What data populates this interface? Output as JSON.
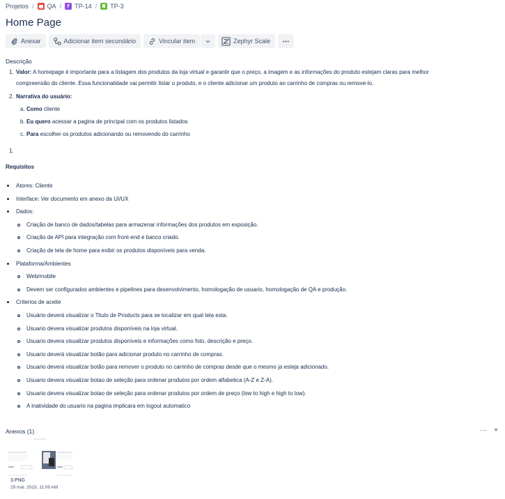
{
  "breadcrumb": {
    "items": [
      {
        "label": "Projetos"
      },
      {
        "label": "QA",
        "icon": "project-icon"
      },
      {
        "label": "TP-14",
        "icon": "epic-icon"
      },
      {
        "label": "TP-3",
        "icon": "story-icon"
      }
    ],
    "separator": "/"
  },
  "issue": {
    "title": "Home Page"
  },
  "toolbar": {
    "attach": "Anexar",
    "child": "Adicionar item secundário",
    "link": "Vincular item",
    "zephyr": "Zephyr Scale"
  },
  "description": {
    "label": "Descrição",
    "item1": {
      "num": "1.",
      "bold": "Valor:",
      "text1": " A homepage é importante para a listagem dos produtos da loja virtual e garantir que o preço, a imagem e as informações do produto estejam claras para melhor",
      "text2": "compreensão do cliente. Essa funcionalidade vai permitir listar o produto, e o cliente adicionar um produto ao carrinho de compras ou remove-lo."
    },
    "item2": {
      "num": "2.",
      "bold": "Narrativa do usuário:",
      "sub": [
        {
          "letter": "a.",
          "bold": "Como",
          "text": " cliente"
        },
        {
          "letter": "b.",
          "bold": "Eu quero",
          "text": " acessar a pagina de principal com os produtos listados"
        },
        {
          "letter": "c.",
          "bold": "Para",
          "text": " escolher os produtos adicionando ou removendo do carrinho"
        }
      ]
    },
    "item3": {
      "num": "1."
    }
  },
  "requirements": {
    "label": "Requisitos",
    "items": [
      {
        "text": "Atores: Cliente"
      },
      {
        "text": "Interface: Ver documento em anexo da UI/UX"
      },
      {
        "text": "Dados:"
      },
      {
        "text": "Criação de banco de dados/tabelas para armazenar informações dos produtos em exposição.",
        "level": 2
      },
      {
        "text": "Criação de API para integração com front-end e banco criado.",
        "level": 2
      },
      {
        "text": "Criação de tela de home para exibir os produtos disponíveis para venda.",
        "level": 2
      },
      {
        "text": "Plataforma/Ambientes"
      },
      {
        "text": "Web/mobile",
        "level": 2
      },
      {
        "text": "Devem ser configurados ambientes e pipelines para desenvolvimento, homologação de usuario, homologação de QA e produção.",
        "level": 2
      },
      {
        "text": "Criterios de aceite"
      },
      {
        "text": "Usuário deverá visualizar o Titulo de Products para se localizar em qual tela esta.",
        "level": 2
      },
      {
        "text": "Usuario devera visualizar produtos disponíveis na loja virtual.",
        "level": 2
      },
      {
        "text": "Usuario devera visualizar produtos disponíveis e informações como foto, descrição e preço.",
        "level": 2
      },
      {
        "text": "Usuario deverá visualizar botão para adicionar produto no carrinho de compras.",
        "level": 2
      },
      {
        "text": "Usuario deverá visualizar botão para remover o produto no carrinho de compras desde que o mesmo ja esteja adicionado.",
        "level": 2
      },
      {
        "text": "Usuario devera visualizar botao de seleção para ordenar produtos por ordem alfabetica (A-Z e Z-A).",
        "level": 2
      },
      {
        "text": "Usuario devera visualizar botao de seleção  para ordenar produtos por ordem de preço (low to high e high to low).",
        "level": 2
      },
      {
        "text": "A inatividade do usuario na pagina implicara em logout automatico",
        "level": 2
      }
    ]
  },
  "attachments": {
    "label": "Anexos (1)",
    "more": "···",
    "add": "+",
    "file": {
      "name": "3.PNG",
      "date": "29 mai. 2023, 11:09 AM"
    }
  }
}
